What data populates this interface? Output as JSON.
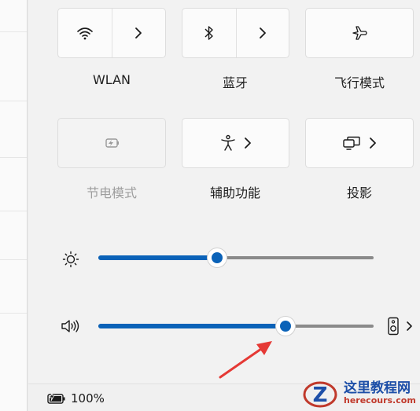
{
  "quick_settings": {
    "wlan": {
      "label": "WLAN",
      "icon": "wifi-icon",
      "chevron": "chevron-right-icon"
    },
    "bluetooth": {
      "label": "蓝牙",
      "icon": "bluetooth-icon",
      "chevron": "chevron-right-icon"
    },
    "airplane": {
      "label": "飞行模式",
      "icon": "airplane-icon"
    },
    "battery_saver": {
      "label": "节电模式",
      "icon": "battery-saver-icon",
      "disabled": true
    },
    "accessibility": {
      "label": "辅助功能",
      "icon": "accessibility-icon",
      "chevron": "chevron-right-icon"
    },
    "cast": {
      "label": "投影",
      "icon": "cast-icon",
      "chevron": "chevron-right-icon"
    }
  },
  "brightness": {
    "icon": "brightness-icon",
    "level_percent": 43
  },
  "volume": {
    "icon": "speaker-icon",
    "level_percent": 68,
    "output_icon": "audio-output-icon"
  },
  "status": {
    "battery_text": "100%",
    "battery_icon": "battery-charging-icon"
  },
  "watermark": {
    "title": "这里教程网",
    "url": "herecours.com",
    "logo_letter": "Z"
  },
  "colors": {
    "accent": "#0a62b8",
    "track": "#8a8a8a",
    "arrow": "#e53935"
  }
}
